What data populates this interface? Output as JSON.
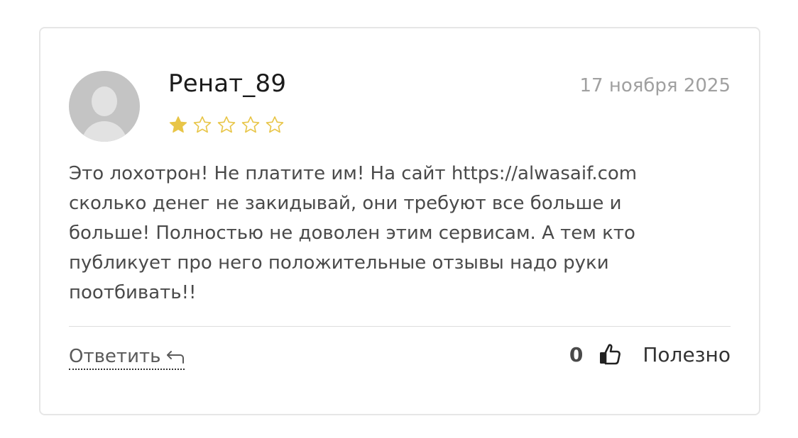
{
  "review": {
    "author": "Ренат_89",
    "date": "17 ноября 2025",
    "rating": 1,
    "rating_max": 5,
    "text": "Это лохотрон! Не платите им! На сайт https://alwasaif.com сколько денег не закидывай, они требуют все больше и больше! Полностью не доволен этим сервисам. А тем кто публикует про него положительные отзывы надо руки поотбивать!!"
  },
  "actions": {
    "reply_label": "Ответить",
    "helpful_count": "0",
    "helpful_label": "Полезно"
  },
  "colors": {
    "star_filled": "#e8c547",
    "star_empty_stroke": "#e8c547",
    "text": "#4a4a4a",
    "date": "#a0a0a0"
  },
  "icons": {
    "avatar": "user-placeholder-icon",
    "reply": "reply-arrow-icon",
    "helpful": "thumbs-up-icon"
  }
}
